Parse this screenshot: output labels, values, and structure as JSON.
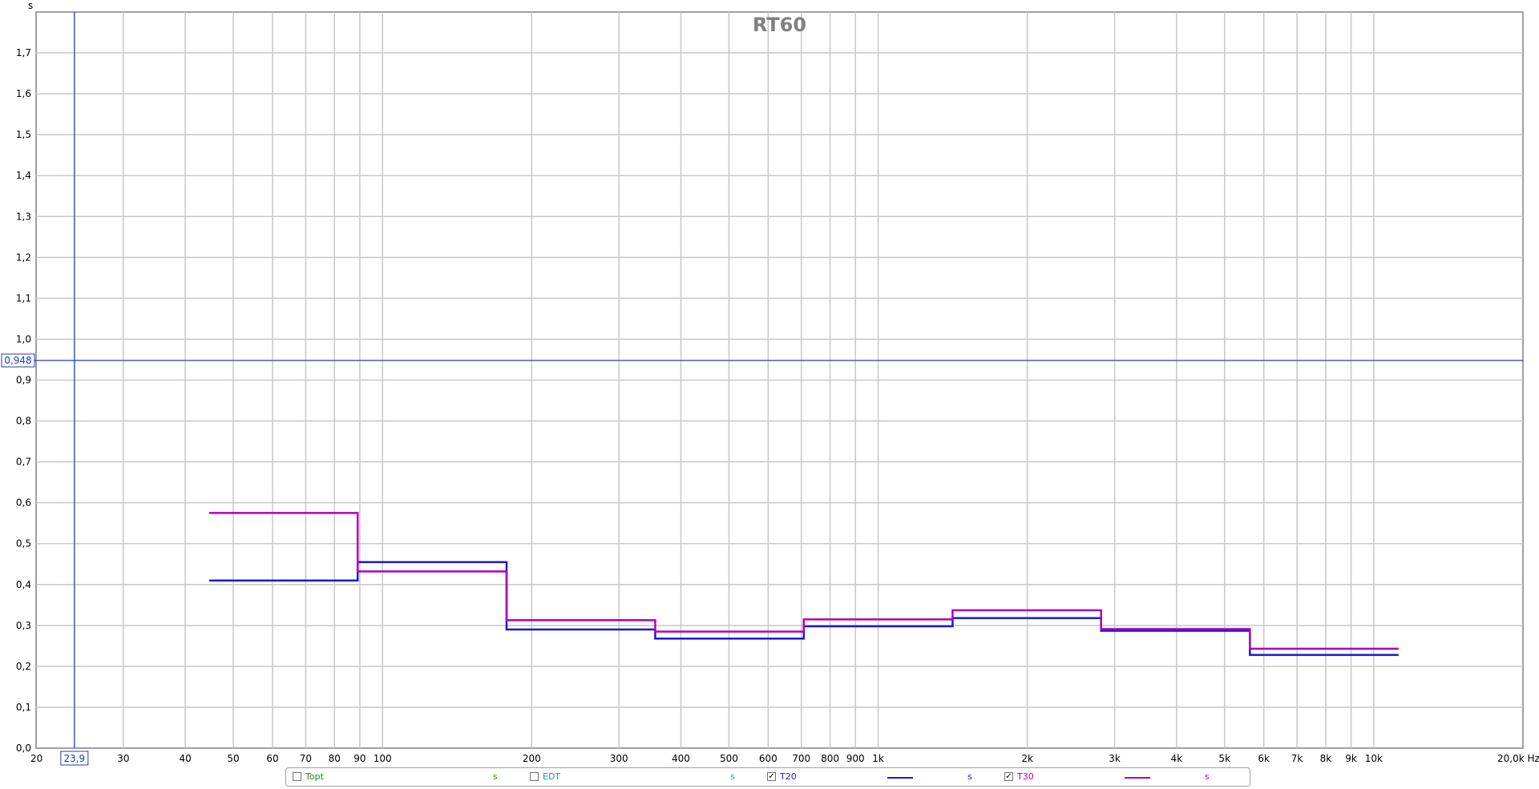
{
  "chart_data": {
    "type": "line",
    "title": "RT60",
    "ylabel": "s",
    "xlabel": "Hz",
    "x_scale": "log",
    "xlim": [
      20,
      20000
    ],
    "ylim": [
      0,
      1.8
    ],
    "grid": true,
    "x_ticks": [
      {
        "value": 20,
        "label": "20"
      },
      {
        "value": 30,
        "label": "30"
      },
      {
        "value": 40,
        "label": "40"
      },
      {
        "value": 50,
        "label": "50"
      },
      {
        "value": 60,
        "label": "60"
      },
      {
        "value": 70,
        "label": "70"
      },
      {
        "value": 80,
        "label": "80"
      },
      {
        "value": 90,
        "label": "90"
      },
      {
        "value": 100,
        "label": "100"
      },
      {
        "value": 200,
        "label": "200"
      },
      {
        "value": 300,
        "label": "300"
      },
      {
        "value": 400,
        "label": "400"
      },
      {
        "value": 500,
        "label": "500"
      },
      {
        "value": 600,
        "label": "600"
      },
      {
        "value": 700,
        "label": "700"
      },
      {
        "value": 800,
        "label": "800"
      },
      {
        "value": 900,
        "label": "900"
      },
      {
        "value": 1000,
        "label": "1k"
      },
      {
        "value": 2000,
        "label": "2k"
      },
      {
        "value": 3000,
        "label": "3k"
      },
      {
        "value": 4000,
        "label": "4k"
      },
      {
        "value": 5000,
        "label": "5k"
      },
      {
        "value": 6000,
        "label": "6k"
      },
      {
        "value": 7000,
        "label": "7k"
      },
      {
        "value": 8000,
        "label": "8k"
      },
      {
        "value": 9000,
        "label": "9k"
      },
      {
        "value": 10000,
        "label": "10k"
      },
      {
        "value": 20000,
        "label": "20,0k Hz"
      }
    ],
    "y_ticks": [
      {
        "value": 0.0,
        "label": "0,0"
      },
      {
        "value": 0.1,
        "label": "0,1"
      },
      {
        "value": 0.2,
        "label": "0,2"
      },
      {
        "value": 0.3,
        "label": "0,3"
      },
      {
        "value": 0.4,
        "label": "0,4"
      },
      {
        "value": 0.5,
        "label": "0,5"
      },
      {
        "value": 0.6,
        "label": "0,6"
      },
      {
        "value": 0.7,
        "label": "0,7"
      },
      {
        "value": 0.8,
        "label": "0,8"
      },
      {
        "value": 0.9,
        "label": "0,9"
      },
      {
        "value": 1.0,
        "label": "1,0"
      },
      {
        "value": 1.1,
        "label": "1,1"
      },
      {
        "value": 1.2,
        "label": "1,2"
      },
      {
        "value": 1.3,
        "label": "1,3"
      },
      {
        "value": 1.4,
        "label": "1,4"
      },
      {
        "value": 1.5,
        "label": "1,5"
      },
      {
        "value": 1.6,
        "label": "1,6"
      },
      {
        "value": 1.7,
        "label": "1,7"
      }
    ],
    "cursor": {
      "x": 23.9,
      "y": 0.948,
      "x_label": "23,9",
      "y_label": "0,948"
    },
    "band_edges": [
      44.7,
      89.1,
      178,
      355,
      708,
      1413,
      2818,
      5623,
      11220
    ],
    "series": [
      {
        "name": "T20",
        "color": "#1a1ad0",
        "values": [
          0.41,
          0.455,
          0.29,
          0.268,
          0.298,
          0.318,
          0.287,
          0.228
        ]
      },
      {
        "name": "T30",
        "color": "#b000b8",
        "values": [
          0.575,
          0.432,
          0.313,
          0.285,
          0.315,
          0.337,
          0.291,
          0.243
        ]
      }
    ],
    "legend": [
      {
        "name": "Topt",
        "checked": false,
        "color": "#1a8a1a",
        "unit": "s"
      },
      {
        "name": "EDT",
        "checked": false,
        "color": "#1aa0a0",
        "unit": "s"
      },
      {
        "name": "T20",
        "checked": true,
        "color": "#1a1ad0",
        "unit": "s"
      },
      {
        "name": "T30",
        "checked": true,
        "color": "#b000b8",
        "unit": "s"
      }
    ]
  }
}
